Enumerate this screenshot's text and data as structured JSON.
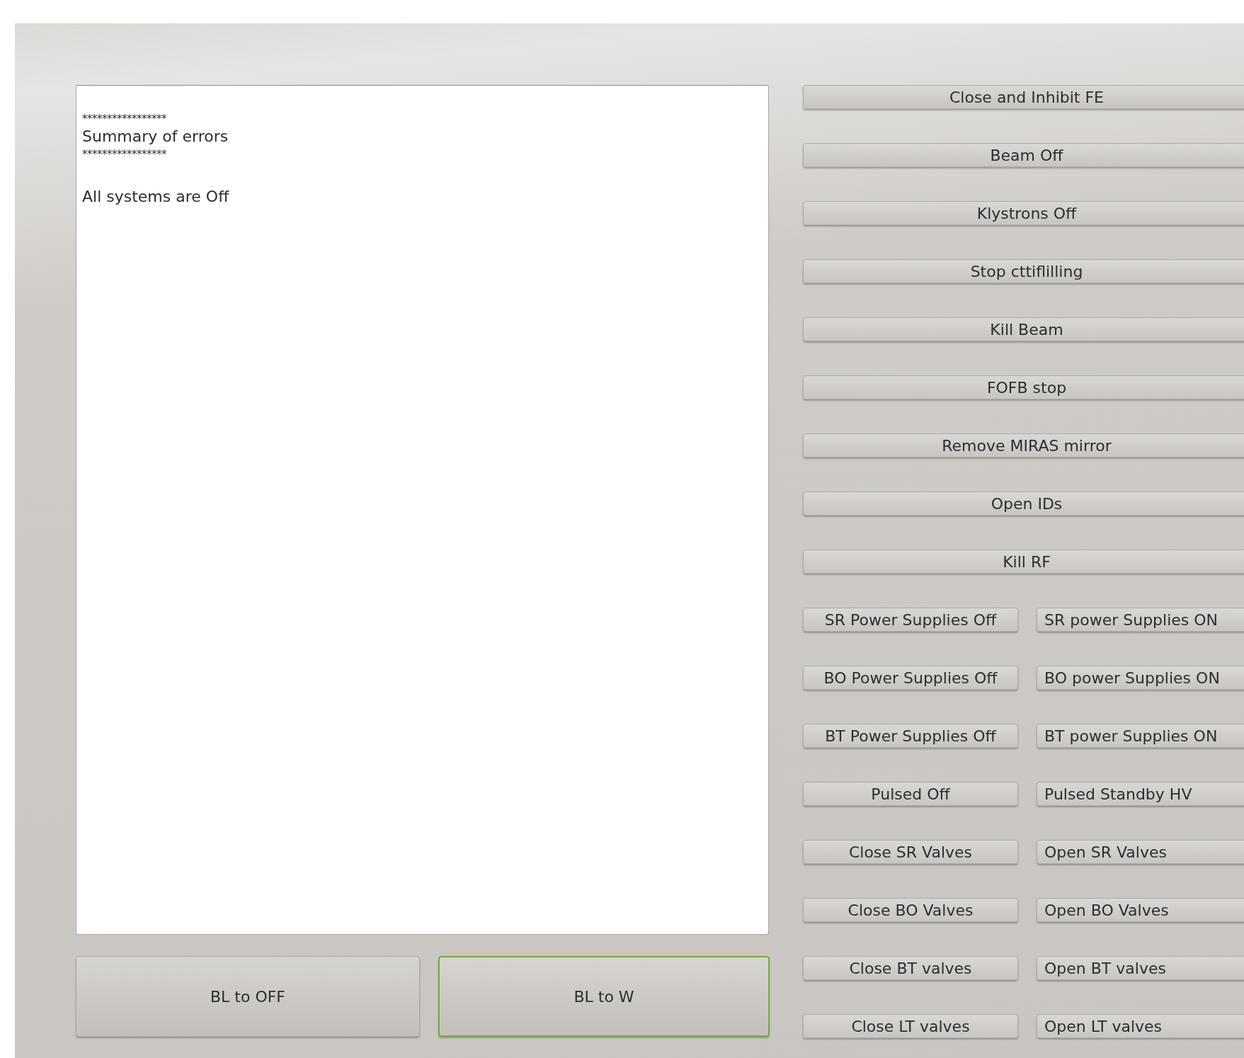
{
  "log": {
    "lines": [
      {
        "kind": "rule",
        "text": "*****************"
      },
      {
        "kind": "heading",
        "text": "Summary of errors"
      },
      {
        "kind": "rule",
        "text": "*****************"
      },
      {
        "kind": "message",
        "text": "All systems are Off"
      }
    ]
  },
  "actions": [
    {
      "buttons": [
        "Close and Inhibit FE"
      ]
    },
    {
      "buttons": [
        "Beam Off"
      ]
    },
    {
      "buttons": [
        "Klystrons Off"
      ]
    },
    {
      "buttons": [
        "Stop cttiflilling"
      ]
    },
    {
      "buttons": [
        "Kill Beam"
      ]
    },
    {
      "buttons": [
        "FOFB stop"
      ]
    },
    {
      "buttons": [
        "Remove MIRAS mirror"
      ]
    },
    {
      "buttons": [
        "Open IDs"
      ]
    },
    {
      "buttons": [
        "Kill RF"
      ]
    },
    {
      "buttons": [
        "SR Power Supplies Off",
        "SR power Supplies ON"
      ]
    },
    {
      "buttons": [
        "BO Power Supplies Off",
        "BO power Supplies ON"
      ]
    },
    {
      "buttons": [
        "BT Power Supplies Off",
        "BT power Supplies ON"
      ]
    },
    {
      "buttons": [
        "Pulsed Off",
        "Pulsed Standby HV"
      ]
    },
    {
      "buttons": [
        "Close SR Valves",
        "Open SR Valves"
      ]
    },
    {
      "buttons": [
        "Close BO Valves",
        "Open BO Valves"
      ]
    },
    {
      "buttons": [
        "Close BT valves",
        "Open BT valves"
      ]
    },
    {
      "buttons": [
        "Close LT valves",
        "Open LT valves"
      ]
    }
  ],
  "bottom_buttons": [
    {
      "label": "BL to OFF",
      "focused": false
    },
    {
      "label": "BL to W",
      "focused": true
    }
  ]
}
